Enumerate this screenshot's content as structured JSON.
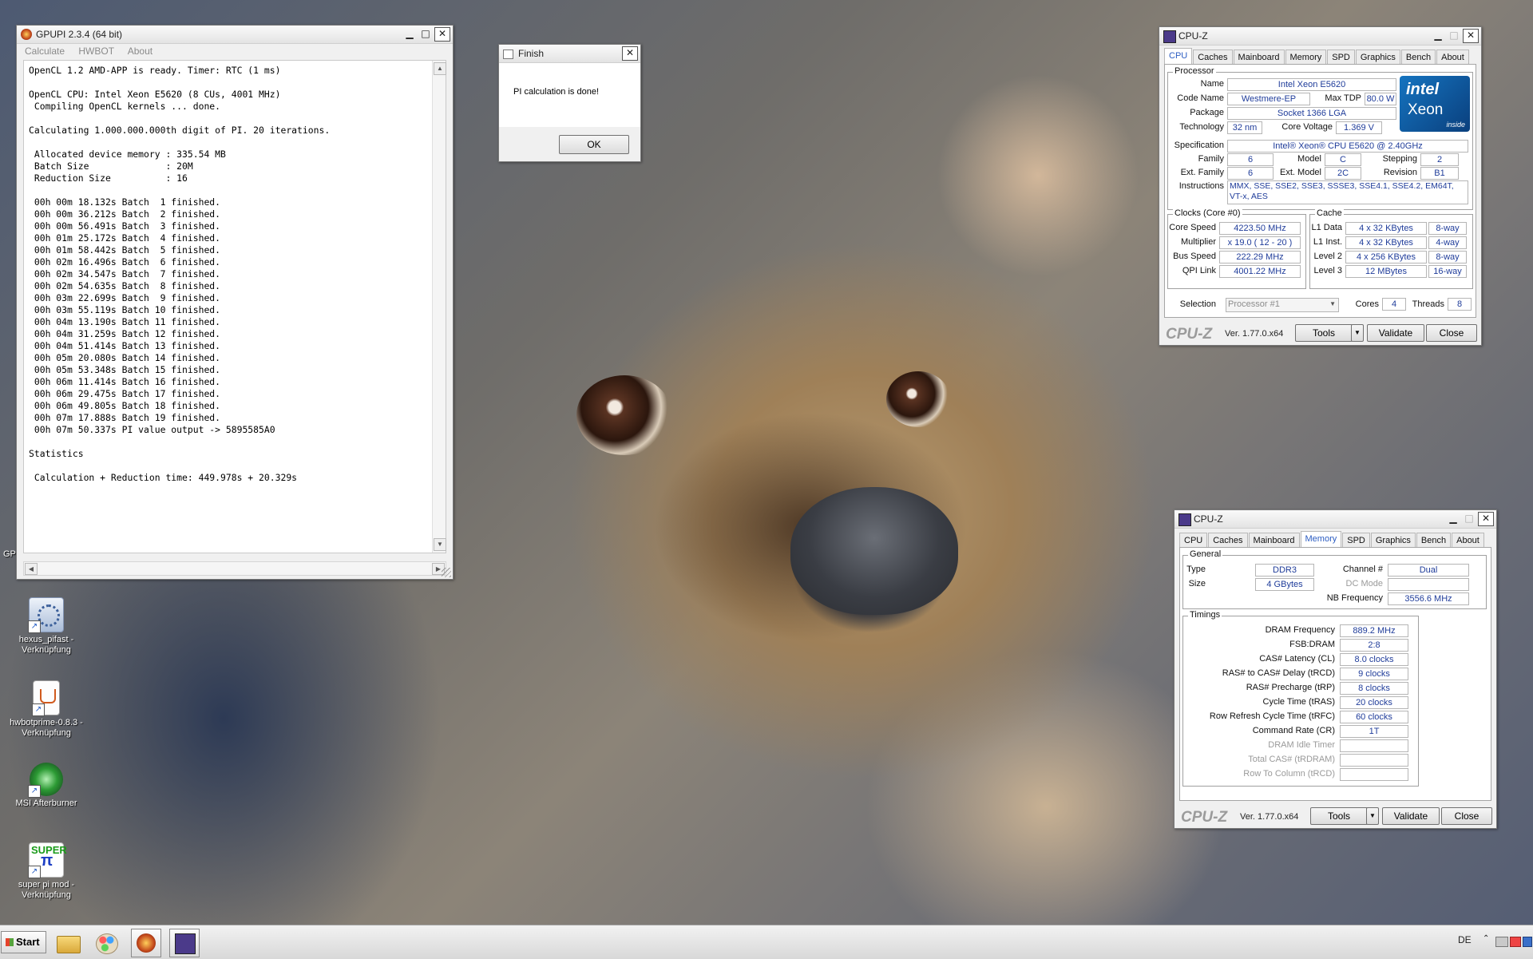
{
  "gpupi": {
    "title": "GPUPI 2.3.4 (64 bit)",
    "menu": [
      "Calculate",
      "HWBOT",
      "About"
    ],
    "console_text": "OpenCL 1.2 AMD-APP is ready. Timer: RTC (1 ms)\n\nOpenCL CPU: Intel Xeon E5620 (8 CUs, 4001 MHz)\n Compiling OpenCL kernels ... done.\n\nCalculating 1.000.000.000th digit of PI. 20 iterations.\n\n Allocated device memory : 335.54 MB\n Batch Size              : 20M\n Reduction Size          : 16\n\n 00h 00m 18.132s Batch  1 finished.\n 00h 00m 36.212s Batch  2 finished.\n 00h 00m 56.491s Batch  3 finished.\n 00h 01m 25.172s Batch  4 finished.\n 00h 01m 58.442s Batch  5 finished.\n 00h 02m 16.496s Batch  6 finished.\n 00h 02m 34.547s Batch  7 finished.\n 00h 02m 54.635s Batch  8 finished.\n 00h 03m 22.699s Batch  9 finished.\n 00h 03m 55.119s Batch 10 finished.\n 00h 04m 13.190s Batch 11 finished.\n 00h 04m 31.259s Batch 12 finished.\n 00h 04m 51.414s Batch 13 finished.\n 00h 05m 20.080s Batch 14 finished.\n 00h 05m 53.348s Batch 15 finished.\n 00h 06m 11.414s Batch 16 finished.\n 00h 06m 29.475s Batch 17 finished.\n 00h 06m 49.805s Batch 18 finished.\n 00h 07m 17.888s Batch 19 finished.\n 00h 07m 50.337s PI value output -> 5895585A0\n\nStatistics\n\n Calculation + Reduction time: 449.978s + 20.329s"
  },
  "finish_dialog": {
    "title": "Finish",
    "message": "PI calculation is done!",
    "ok_label": "OK"
  },
  "cpuz_cpu": {
    "title": "CPU-Z",
    "tabs": [
      "CPU",
      "Caches",
      "Mainboard",
      "Memory",
      "SPD",
      "Graphics",
      "Bench",
      "About"
    ],
    "processor_group": "Processor",
    "name_label": "Name",
    "name": "Intel Xeon E5620",
    "codename_label": "Code Name",
    "codename": "Westmere-EP",
    "maxtdp_label": "Max TDP",
    "maxtdp": "80.0 W",
    "package_label": "Package",
    "package": "Socket 1366 LGA",
    "technology_label": "Technology",
    "technology": "32 nm",
    "corevoltage_label": "Core Voltage",
    "corevoltage": "1.369 V",
    "spec_label": "Specification",
    "spec": "Intel® Xeon® CPU         E5620  @ 2.40GHz",
    "family_label": "Family",
    "family": "6",
    "model_label": "Model",
    "model": "C",
    "stepping_label": "Stepping",
    "stepping": "2",
    "extfamily_label": "Ext. Family",
    "extfamily": "6",
    "extmodel_label": "Ext. Model",
    "extmodel": "2C",
    "revision_label": "Revision",
    "revision": "B1",
    "instructions_label": "Instructions",
    "instructions": "MMX, SSE, SSE2, SSE3, SSSE3, SSE4.1, SSE4.2, EM64T, VT-x, AES",
    "clocks_group": "Clocks (Core #0)",
    "corespeed_label": "Core Speed",
    "corespeed": "4223.50 MHz",
    "multiplier_label": "Multiplier",
    "multiplier": "x 19.0 ( 12 - 20 )",
    "busspeed_label": "Bus Speed",
    "busspeed": "222.29 MHz",
    "qpilink_label": "QPI Link",
    "qpilink": "4001.22 MHz",
    "cache_group": "Cache",
    "l1data_label": "L1 Data",
    "l1data": "4 x 32 KBytes",
    "l1data_way": "8-way",
    "l1inst_label": "L1 Inst.",
    "l1inst": "4 x 32 KBytes",
    "l1inst_way": "4-way",
    "level2_label": "Level 2",
    "level2": "4 x 256 KBytes",
    "level2_way": "8-way",
    "level3_label": "Level 3",
    "level3": "12 MBytes",
    "level3_way": "16-way",
    "selection_label": "Selection",
    "selection": "Processor #1",
    "cores_label": "Cores",
    "cores": "4",
    "threads_label": "Threads",
    "threads": "8",
    "intel_brand": "intel",
    "intel_product": "Xeon",
    "intel_tag": "inside",
    "logo": "CPU-Z",
    "version": "Ver. 1.77.0.x64",
    "tools_label": "Tools",
    "validate_label": "Validate",
    "close_label": "Close"
  },
  "cpuz_mem": {
    "title": "CPU-Z",
    "tabs": [
      "CPU",
      "Caches",
      "Mainboard",
      "Memory",
      "SPD",
      "Graphics",
      "Bench",
      "About"
    ],
    "general_group": "General",
    "type_label": "Type",
    "type": "DDR3",
    "size_label": "Size",
    "size": "4 GBytes",
    "channel_label": "Channel #",
    "channel": "Dual",
    "dcmode_label": "DC Mode",
    "dcmode": "",
    "nbfreq_label": "NB Frequency",
    "nbfreq": "3556.6 MHz",
    "timings_group": "Timings",
    "timings": [
      {
        "label": "DRAM Frequency",
        "value": "889.2 MHz",
        "dim": false
      },
      {
        "label": "FSB:DRAM",
        "value": "2:8",
        "dim": false
      },
      {
        "label": "CAS# Latency (CL)",
        "value": "8.0 clocks",
        "dim": false
      },
      {
        "label": "RAS# to CAS# Delay (tRCD)",
        "value": "9 clocks",
        "dim": false
      },
      {
        "label": "RAS# Precharge (tRP)",
        "value": "8 clocks",
        "dim": false
      },
      {
        "label": "Cycle Time (tRAS)",
        "value": "20 clocks",
        "dim": false
      },
      {
        "label": "Row Refresh Cycle Time (tRFC)",
        "value": "60 clocks",
        "dim": false
      },
      {
        "label": "Command Rate (CR)",
        "value": "1T",
        "dim": false
      },
      {
        "label": "DRAM Idle Timer",
        "value": "",
        "dim": true
      },
      {
        "label": "Total CAS# (tRDRAM)",
        "value": "",
        "dim": true
      },
      {
        "label": "Row To Column (tRCD)",
        "value": "",
        "dim": true
      }
    ],
    "logo": "CPU-Z",
    "version": "Ver. 1.77.0.x64",
    "tools_label": "Tools",
    "validate_label": "Validate",
    "close_label": "Close"
  },
  "desktop_icons": [
    {
      "label": "hexus_pifast - Verknüpfung",
      "icon": "pifast-icon"
    },
    {
      "label": "hwbotprime-0.8.3 - Verknüpfung",
      "icon": "java-icon"
    },
    {
      "label": "MSI Afterburner",
      "icon": "afterburner-icon"
    },
    {
      "label": "super pi mod - Verknüpfung",
      "icon": "superpi-icon"
    }
  ],
  "desktop_partial_label": "GP",
  "taskbar": {
    "start_label": "Start",
    "language": "DE"
  },
  "colors": {
    "cpuz_value": "#1f3c9a",
    "cpuz_active_tab": "#2b5cc2",
    "intel_blue": "#1574c0"
  }
}
